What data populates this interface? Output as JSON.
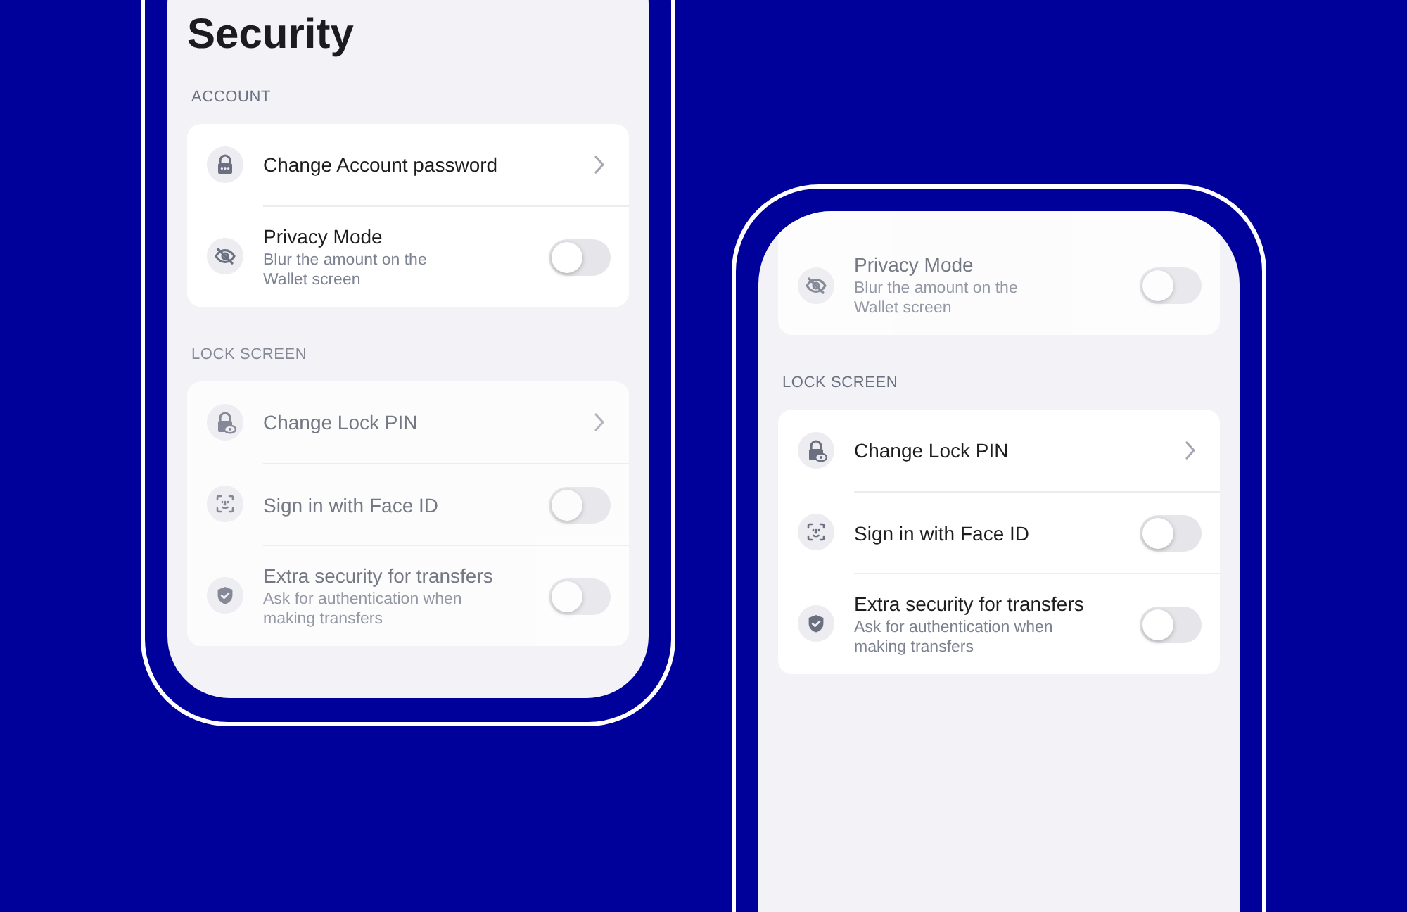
{
  "screens": [
    {
      "title": "Security",
      "cut_top": false,
      "sections": [
        {
          "header": "ACCOUNT",
          "blurred": false,
          "rows": [
            {
              "kind": "link",
              "title": "Change Account password"
            },
            {
              "kind": "toggle",
              "title": "Privacy Mode",
              "subtitle": "Blur the amount on the Wallet screen",
              "on": false
            }
          ]
        },
        {
          "header": "LOCK SCREEN",
          "blurred": true,
          "rows": [
            {
              "kind": "link",
              "title": "Change Lock PIN"
            },
            {
              "kind": "toggle",
              "title": "Sign in with Face ID",
              "on": false
            },
            {
              "kind": "toggle",
              "title": "Extra security for transfers",
              "subtitle": "Ask for authentication when making transfers",
              "on": false
            }
          ]
        }
      ]
    },
    {
      "cut_top": true,
      "sections": [
        {
          "blurred": true,
          "rows": [
            {
              "kind": "toggle",
              "title": "Privacy Mode",
              "subtitle": "Blur the amount on the Wallet screen",
              "on": false
            }
          ]
        },
        {
          "header": "LOCK SCREEN",
          "blurred": false,
          "rows": [
            {
              "kind": "link",
              "title": "Change Lock PIN"
            },
            {
              "kind": "toggle",
              "title": "Sign in with Face ID",
              "on": false
            },
            {
              "kind": "toggle",
              "title": "Extra security for transfers",
              "subtitle": "Ask for authentication when making transfers",
              "on": false
            }
          ]
        }
      ]
    }
  ]
}
